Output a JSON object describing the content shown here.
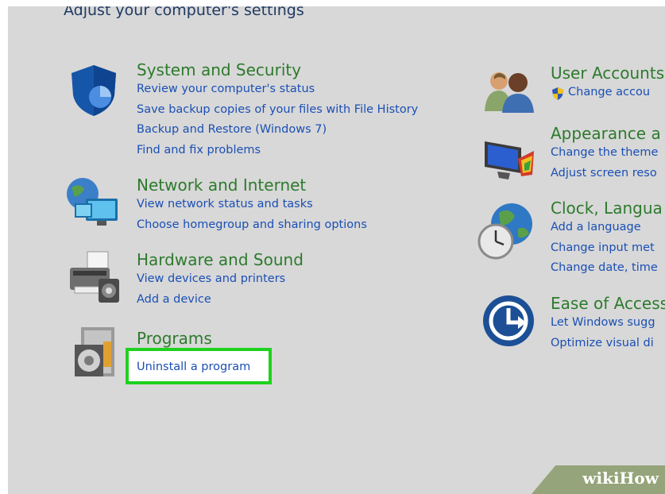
{
  "page": {
    "title": "Adjust your computer's settings"
  },
  "left": [
    {
      "id": "system",
      "title": "System and Security",
      "links": [
        "Review your computer's status",
        "Save backup copies of your files with File History",
        "Backup and Restore (Windows 7)",
        "Find and fix problems"
      ]
    },
    {
      "id": "network",
      "title": "Network and Internet",
      "links": [
        "View network status and tasks",
        "Choose homegroup and sharing options"
      ]
    },
    {
      "id": "hardware",
      "title": "Hardware and Sound",
      "links": [
        "View devices and printers",
        "Add a device"
      ]
    },
    {
      "id": "programs",
      "title": "Programs",
      "links": [
        "Uninstall a program"
      ]
    }
  ],
  "right": [
    {
      "id": "users",
      "title": "User Accounts",
      "links": [
        "Change accou"
      ]
    },
    {
      "id": "appearance",
      "title": "Appearance a",
      "links": [
        "Change the theme",
        "Adjust screen reso"
      ]
    },
    {
      "id": "clock",
      "title": "Clock, Langua",
      "links": [
        "Add a language",
        "Change input met",
        "Change date, time"
      ]
    },
    {
      "id": "ease",
      "title": "Ease of Access",
      "links": [
        "Let Windows sugg",
        "Optimize visual di"
      ]
    }
  ],
  "icons": {
    "system": "shield-icon",
    "network": "network-globe-icon",
    "hardware": "printer-icon",
    "programs": "programs-disc-icon",
    "users": "user-accounts-icon",
    "appearance": "appearance-monitor-icon",
    "clock": "clock-globe-icon",
    "ease": "ease-of-access-icon"
  },
  "highlight": {
    "color": "#1fd11f"
  },
  "watermark": "wikiHow"
}
